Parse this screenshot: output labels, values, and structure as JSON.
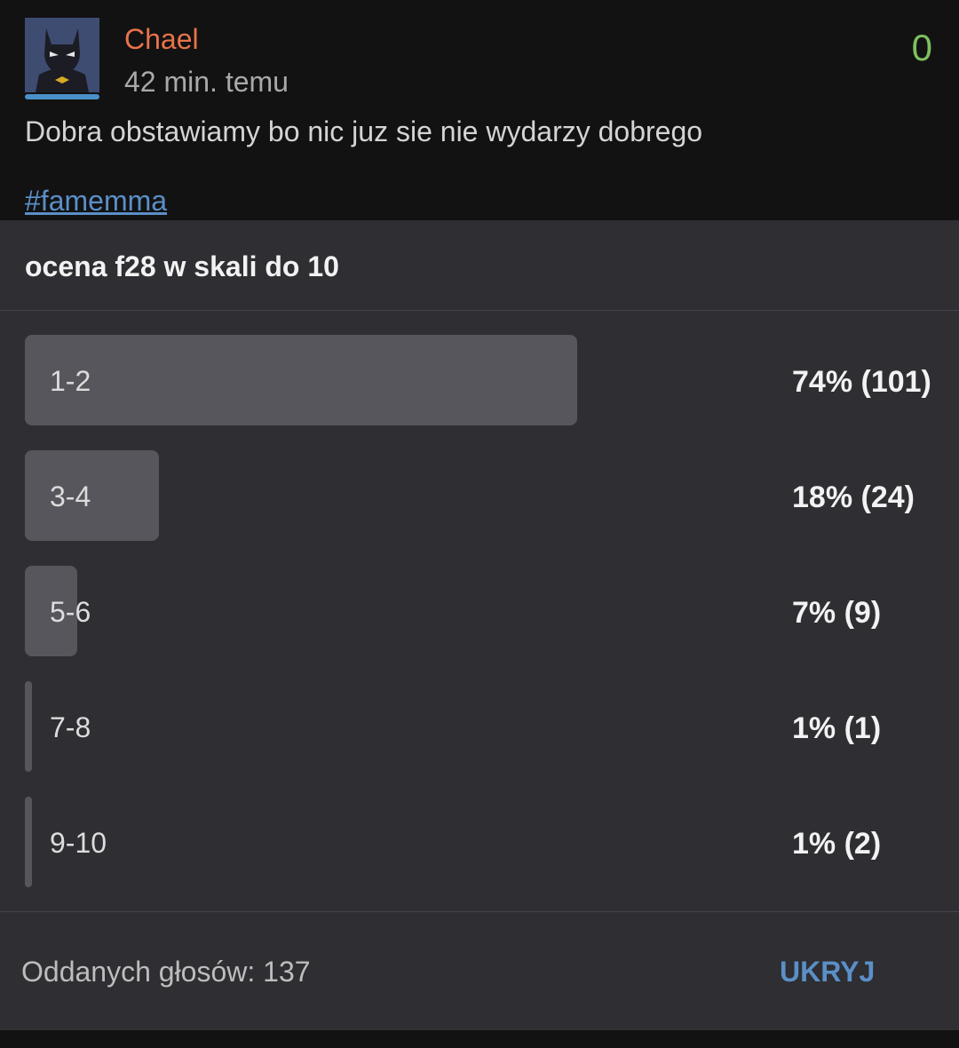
{
  "post": {
    "username": "Chael",
    "time": "42 min. temu",
    "score": "0",
    "body": "Dobra obstawiamy bo nic juz sie nie wydarzy dobrego",
    "hashtag": "#famemma"
  },
  "poll": {
    "title": "ocena f28 w skali do 10",
    "options": [
      {
        "label": "1-2",
        "result": "74% (101)",
        "percent": 74
      },
      {
        "label": "3-4",
        "result": "18% (24)",
        "percent": 18
      },
      {
        "label": "5-6",
        "result": "7% (9)",
        "percent": 7
      },
      {
        "label": "7-8",
        "result": "1% (1)",
        "percent": 1
      },
      {
        "label": "9-10",
        "result": "1% (2)",
        "percent": 1
      }
    ],
    "votes_text": "Oddanych głosów: 137",
    "hide_label": "UKRYJ"
  },
  "colors": {
    "username": "#e8734a",
    "score": "#7fbf5f",
    "link": "#5b8fc7",
    "poll_background": "#2e2e33",
    "bar": "#56565c"
  },
  "icons": {
    "avatar": "batman-avatar-icon"
  }
}
